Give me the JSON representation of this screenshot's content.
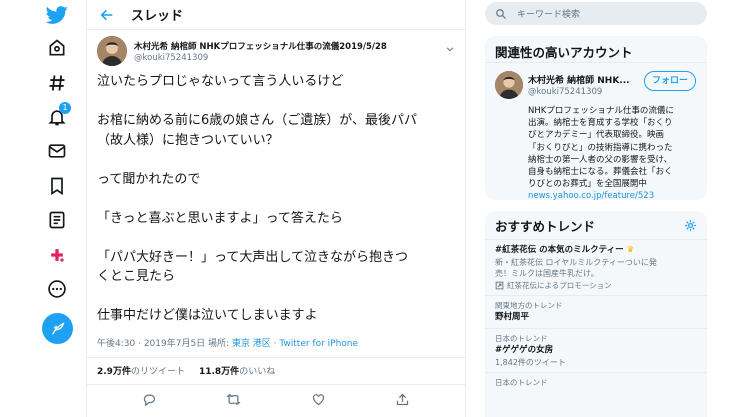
{
  "header": {
    "title": "スレッド"
  },
  "tweet": {
    "author_name": "木村光希 納棺師 NHKプロフェッショナル仕事の流儀2019/5/28",
    "author_handle": "@kouki75241309",
    "lines": [
      "泣いたらプロじゃないって言う人いるけど",
      "",
      "お棺に納める前に6歳の娘さん（ご遺族）が、最後パパ",
      "（故人様）に抱きついていい？",
      "",
      "って聞かれたので",
      "",
      "「きっと喜ぶと思いますよ」って答えたら",
      "",
      "「パパ大好きー！」って大声出して泣きながら抱きつ",
      "くとこ見たら",
      "",
      "仕事中だけど僕は泣いてしまいますよ"
    ],
    "meta": {
      "time": "午後4:30",
      "sep": " · ",
      "date": "2019年7月5日",
      "place_prefix": " 場所: ",
      "place": "東京 港区",
      "via": "Twitter for iPhone"
    },
    "stats": {
      "retweets": "2.9万件",
      "retweets_label": "のリツイート",
      "likes": "11.8万件",
      "likes_label": "のいいね"
    }
  },
  "nav": {
    "notification_count": "1"
  },
  "search": {
    "placeholder": "キーワード検索"
  },
  "related": {
    "title": "関連性の高いアカウント",
    "name": "木村光希 納棺師 NHK...",
    "handle": "@kouki75241309",
    "follow_label": "フォロー",
    "bio_lines": [
      "NHKプロフェッショナル仕事の流儀に",
      "出演。納棺士を育成する学校「おくり",
      "びとアカデミー」代表取締役。映画",
      "「おくりびと」の技術指導に携わった",
      "納棺士の第一人者の父の影響を受け、",
      "自身も納棺士になる。葬儀会社「おく",
      "りびとのお葬式」を全国展開中"
    ],
    "bio_link": "news.yahoo.co.jp/feature/523"
  },
  "trends": {
    "title": "おすすめトレンド",
    "items": [
      {
        "name": "#紅茶花伝 の本気のミルクティー",
        "desc1": "新・紅茶花伝 ロイヤルミルクティーついに発",
        "desc2": "売！ミルクは国産牛乳だけ。",
        "promo": "紅茶花伝によるプロモーション"
      },
      {
        "meta": "関東地方のトレンド",
        "name": "野村周平"
      },
      {
        "meta": "日本のトレンド",
        "name": "#ゲゲゲの女房",
        "count": "1,842件のツイート"
      },
      {
        "meta": "日本のトレンド"
      }
    ]
  },
  "colors": {
    "accent": "#1da1f2",
    "link": "#1b95e0",
    "secondary": "#657786"
  },
  "icons": [
    "twitter-logo-icon",
    "home-icon",
    "hashtag-icon",
    "bell-icon",
    "mail-icon",
    "bookmark-icon",
    "list-icon",
    "moments-icon",
    "more-icon",
    "compose-icon",
    "back-arrow-icon",
    "chevron-down-icon",
    "reply-icon",
    "retweet-icon",
    "like-icon",
    "share-icon",
    "search-icon",
    "gear-icon",
    "promoted-icon"
  ]
}
